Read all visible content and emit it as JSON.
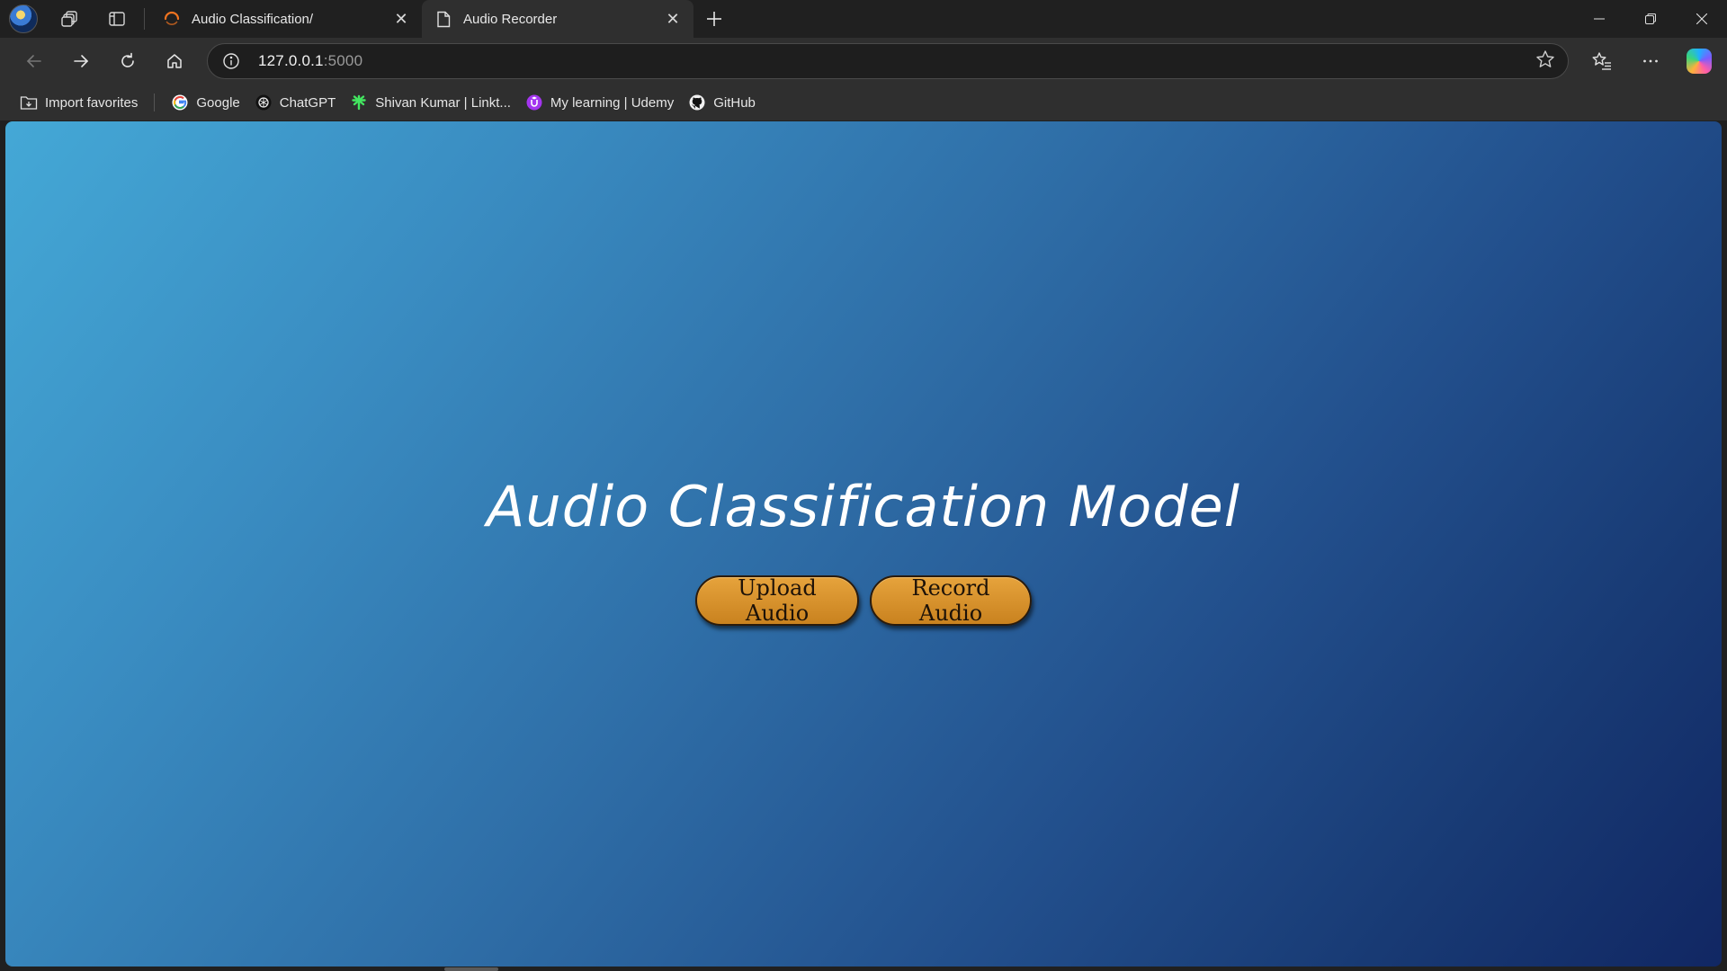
{
  "browser": {
    "tabs": [
      {
        "title": "Audio Classification/",
        "active": false,
        "favicon": "loading-ring-icon"
      },
      {
        "title": "Audio Recorder",
        "active": true,
        "favicon": "document-icon"
      }
    ],
    "url": {
      "host": "127.0.0.1",
      "port": ":5000"
    },
    "bookmarks": [
      {
        "label": "Import favorites",
        "icon": "import-favorites-icon"
      },
      {
        "label": "Google",
        "icon": "google-icon"
      },
      {
        "label": "ChatGPT",
        "icon": "chatgpt-icon"
      },
      {
        "label": "Shivan Kumar | Linkt...",
        "icon": "linktree-icon"
      },
      {
        "label": "My learning | Udemy",
        "icon": "udemy-icon"
      },
      {
        "label": "GitHub",
        "icon": "github-icon"
      }
    ]
  },
  "page": {
    "title": "Audio Classification Model",
    "buttons": {
      "upload": "Upload Audio",
      "record": "Record Audio"
    }
  },
  "colors": {
    "gradient_start": "#44a8d6",
    "gradient_end": "#112763",
    "button": "#d8922c",
    "browser_chrome": "#202020",
    "toolbar": "#2f2f2f"
  }
}
